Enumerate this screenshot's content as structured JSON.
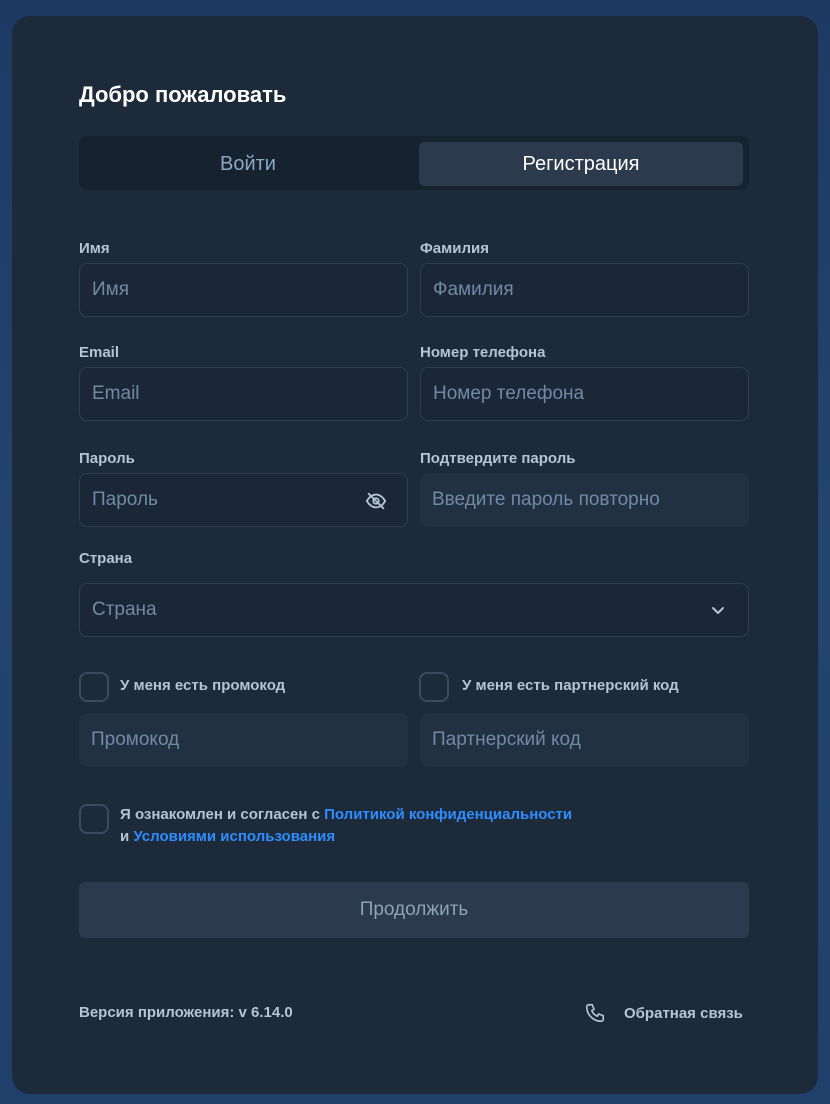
{
  "title": "Добро пожаловать",
  "tabs": {
    "login": "Войти",
    "register": "Регистрация"
  },
  "fields": {
    "first_name": {
      "label": "Имя",
      "placeholder": "Имя"
    },
    "last_name": {
      "label": "Фамилия",
      "placeholder": "Фамилия"
    },
    "email": {
      "label": "Email",
      "placeholder": "Email"
    },
    "phone": {
      "label": "Номер телефона",
      "placeholder": "Номер телефона"
    },
    "password": {
      "label": "Пароль",
      "placeholder": "Пароль"
    },
    "confirm_password": {
      "label": "Подтвердите пароль",
      "placeholder": "Введите пароль повторно"
    },
    "country": {
      "label": "Страна",
      "placeholder": "Страна"
    }
  },
  "promo": {
    "checkbox_label": "У меня есть промокод",
    "placeholder": "Промокод"
  },
  "partner": {
    "checkbox_label": "У меня есть партнерский код",
    "placeholder": "Партнерский код"
  },
  "agreement": {
    "prefix": "Я ознакомлен и согласен с ",
    "privacy_link": "Политикой конфиденциальности",
    "and": "и ",
    "terms_link": "Условиями использования"
  },
  "submit_label": "Продолжить",
  "footer": {
    "version": "Версия приложения: v 6.14.0",
    "feedback": "Обратная связь"
  },
  "colors": {
    "accent_link": "#2f8dff",
    "card_bg": "#1c2a3a",
    "active_tab_bg": "#2b3a4c"
  },
  "icons": {
    "password_toggle": "eye-off-icon",
    "country_dropdown": "chevron-down-icon",
    "feedback": "phone-icon"
  }
}
